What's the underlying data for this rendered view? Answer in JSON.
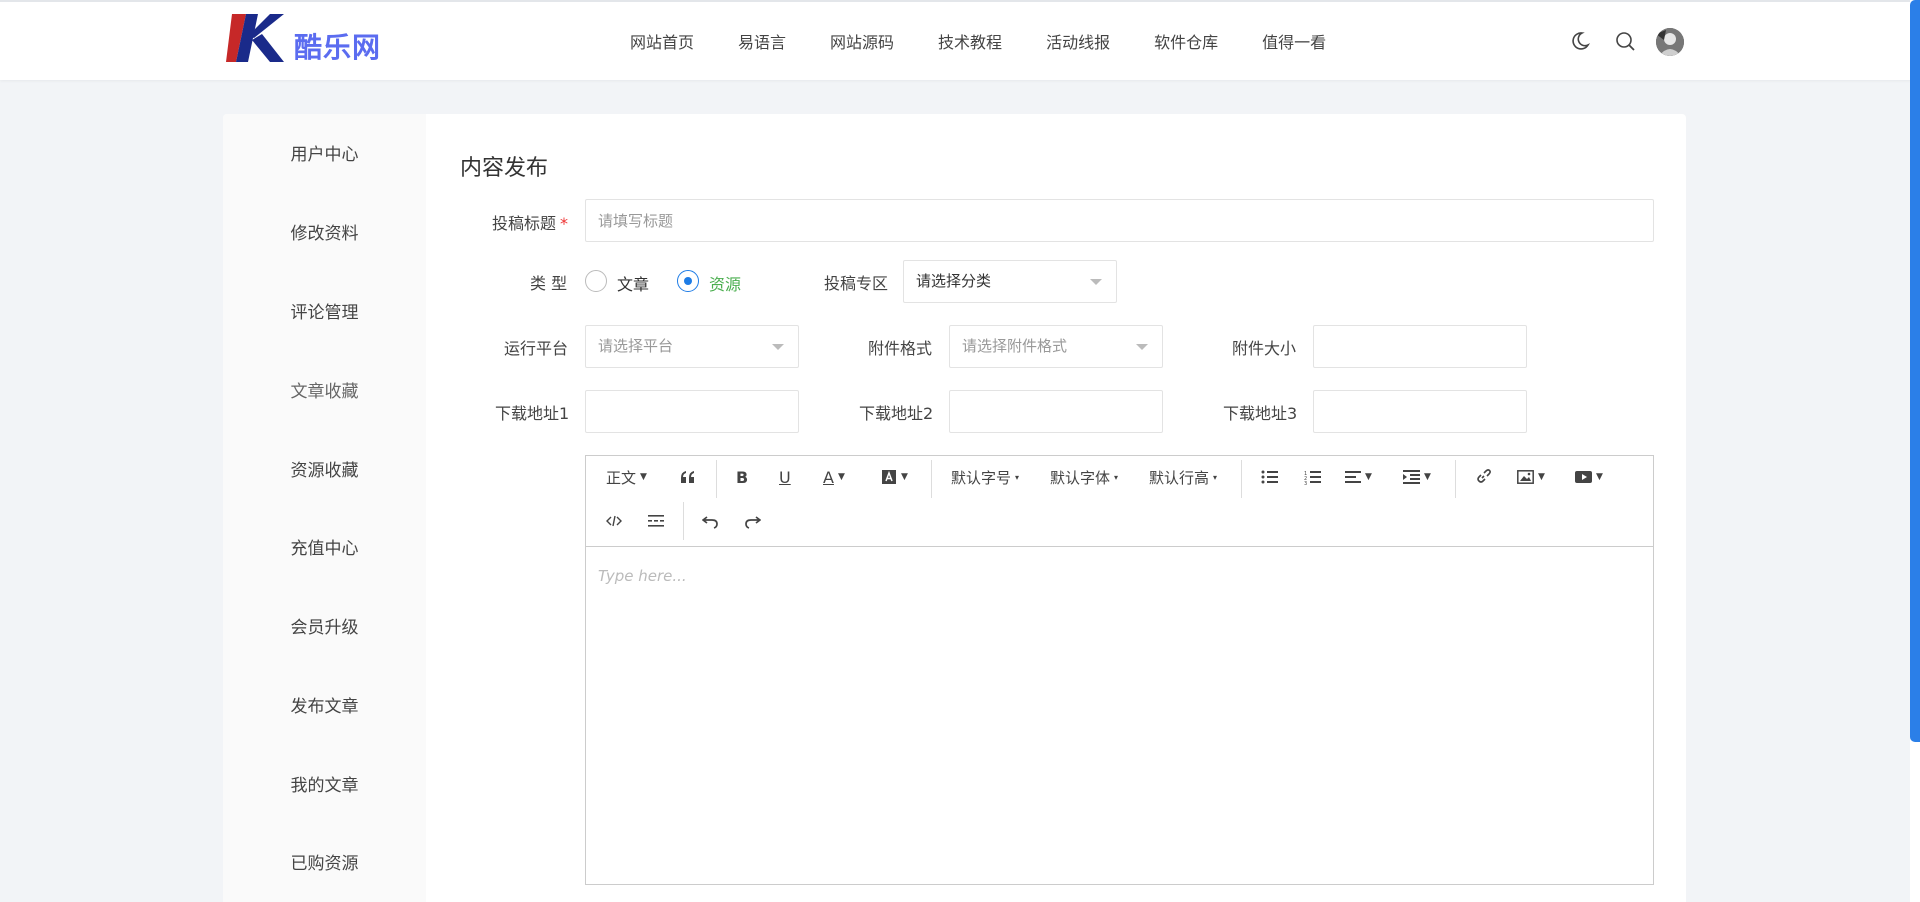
{
  "header": {
    "logo_text": "酷乐网",
    "nav": [
      "网站首页",
      "易语言",
      "网站源码",
      "技术教程",
      "活动线报",
      "软件仓库",
      "值得一看"
    ],
    "icons": [
      "moon-icon",
      "search-icon"
    ]
  },
  "sidebar": {
    "items": [
      "用户中心",
      "修改资料",
      "评论管理",
      "文章收藏",
      "资源收藏",
      "充值中心",
      "会员升级",
      "发布文章",
      "我的文章",
      "已购资源"
    ]
  },
  "form": {
    "title": "内容发布",
    "title_label": "投稿标题",
    "required_mark": "*",
    "title_placeholder": "请填写标题",
    "type_label": "类 型",
    "type_options": [
      "文章",
      "资源"
    ],
    "type_selected": "资源",
    "zone_label": "投稿专区",
    "zone_value": "请选择分类",
    "platform_label": "运行平台",
    "platform_value": "请选择平台",
    "format_label": "附件格式",
    "format_value": "请选择附件格式",
    "size_label": "附件大小",
    "size_value": "",
    "dl1_label": "下载地址1",
    "dl2_label": "下载地址2",
    "dl3_label": "下载地址3"
  },
  "editor": {
    "toolbar": {
      "heading": "正文",
      "font_size": "默认字号",
      "font_family": "默认字体",
      "line_height": "默认行高"
    },
    "placeholder": "Type here..."
  },
  "colors": {
    "accent": "#1e7ce6",
    "brand": "#5b6cf0",
    "scrollbar": "#2b7fe8",
    "selected_option": "#4caf50",
    "required": "#e33333"
  }
}
